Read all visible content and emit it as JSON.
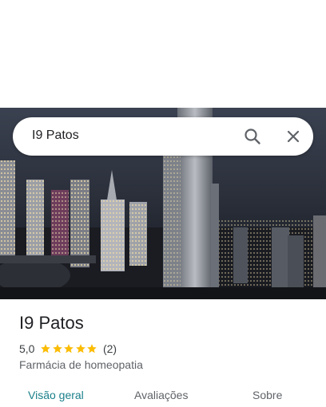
{
  "search": {
    "query": "I9 Patos"
  },
  "place": {
    "name": "I9 Patos",
    "rating": "5,0",
    "stars": 5,
    "review_count": "(2)",
    "category": "Farmácia de homeopatia"
  },
  "tabs": [
    {
      "label": "Visão geral",
      "active": true
    },
    {
      "label": "Avaliações",
      "active": false
    },
    {
      "label": "Sobre",
      "active": false
    }
  ],
  "colors": {
    "accent": "#1a7f8a",
    "star": "#fbbc04"
  },
  "icons": {
    "search": "search-icon",
    "close": "close-icon",
    "star": "star-icon"
  }
}
